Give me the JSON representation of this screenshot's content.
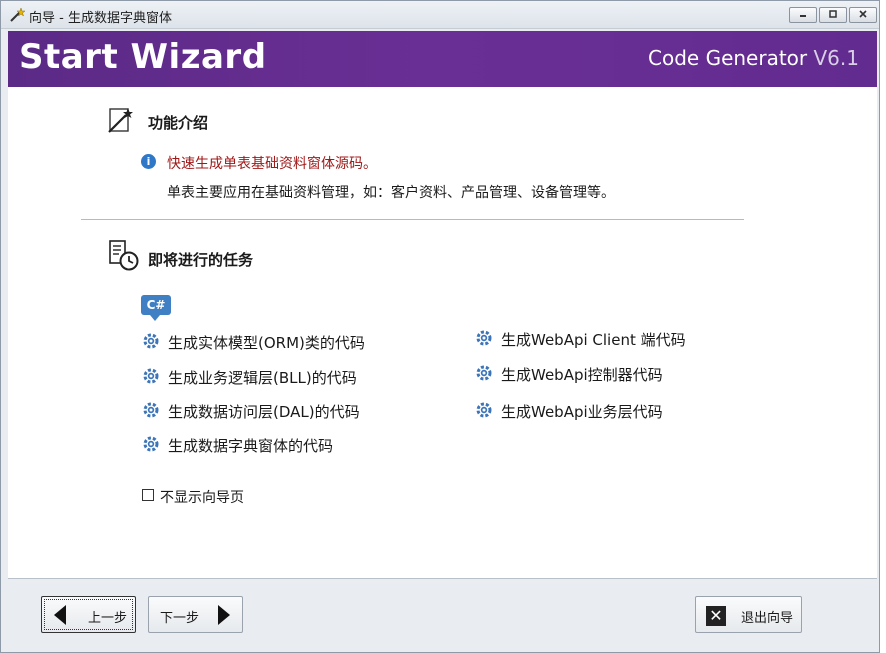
{
  "window": {
    "title": "向导 - 生成数据字典窗体",
    "icon": "wizard-wand-icon"
  },
  "banner": {
    "title": "Start Wizard",
    "product": "Code Generator",
    "version": "V6.1"
  },
  "intro": {
    "heading": "功能介绍",
    "line1": "快速生成单表基础资料窗体源码。",
    "line2": "单表主要应用在基础资料管理，如：客户资料、产品管理、设备管理等。",
    "line1_color": "#a01818"
  },
  "tasks": {
    "heading": "即将进行的任务",
    "badge": "C#",
    "left": [
      "生成实体模型(ORM)类的代码",
      "生成业务逻辑层(BLL)的代码",
      "生成数据访问层(DAL)的代码",
      "生成数据字典窗体的代码"
    ],
    "right": [
      "生成WebApi Client 端代码",
      "生成WebApi控制器代码",
      "生成WebApi业务层代码"
    ]
  },
  "options": {
    "dont_show_label": "不显示向导页",
    "dont_show_checked": false
  },
  "footer": {
    "prev_label": "上一步",
    "next_label": "下一步",
    "exit_label": "退出向导"
  },
  "colors": {
    "banner": "#5b2a86",
    "accent_blue": "#3f7fc4"
  }
}
